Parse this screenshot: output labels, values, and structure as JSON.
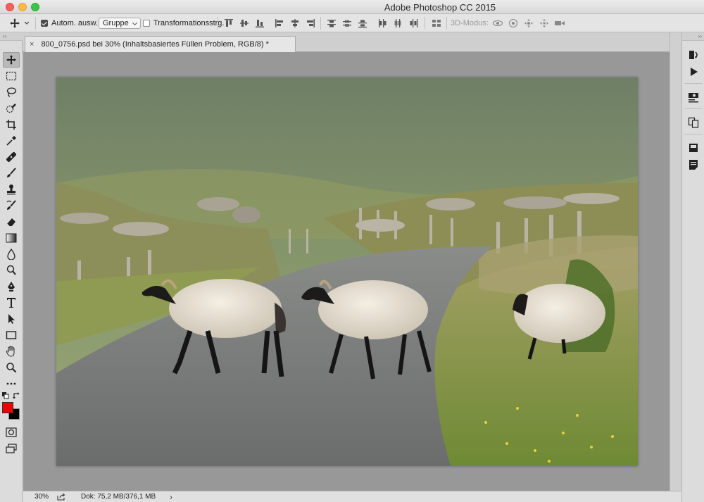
{
  "window": {
    "title": "Adobe Photoshop CC 2015"
  },
  "options_bar": {
    "auto_select_label": "Autom. ausw.:",
    "auto_select_checked": true,
    "auto_select_mode": "Gruppe",
    "transform_controls_label": "Transformationsstrg.",
    "transform_controls_checked": false,
    "mode_3d_label": "3D-Modus:"
  },
  "toolbox": {
    "grip": "››",
    "tools": [
      "move-tool-icon",
      "rectangular-marquee-icon",
      "lasso-icon",
      "quick-selection-icon",
      "crop-icon",
      "eyedropper-icon",
      "healing-brush-icon",
      "brush-icon",
      "clone-stamp-icon",
      "history-brush-icon",
      "eraser-icon",
      "gradient-icon",
      "blur-icon",
      "dodge-icon",
      "pen-icon",
      "type-icon",
      "path-selection-icon",
      "rectangle-icon",
      "hand-icon",
      "zoom-icon",
      "more-tools-icon"
    ],
    "foreground_color": "#f00000",
    "background_color": "#000000"
  },
  "document": {
    "tab_close": "×",
    "tab_title": "800_0756.psd bei 30% (Inhaltsbasiertes Füllen Problem, RGB/8) *"
  },
  "status_bar": {
    "zoom": "30%",
    "doc_info": "Dok: 75,2 MB/376,1 MB",
    "arrow": "›"
  },
  "panels": {
    "grip": "››",
    "buttons": [
      "history-icon",
      "actions-play-icon",
      "properties-icon",
      "libraries-icon",
      "layers-icon",
      "notes-icon"
    ]
  },
  "colors": {
    "accent_red": "#f00000",
    "canvas_gray": "#989898"
  }
}
